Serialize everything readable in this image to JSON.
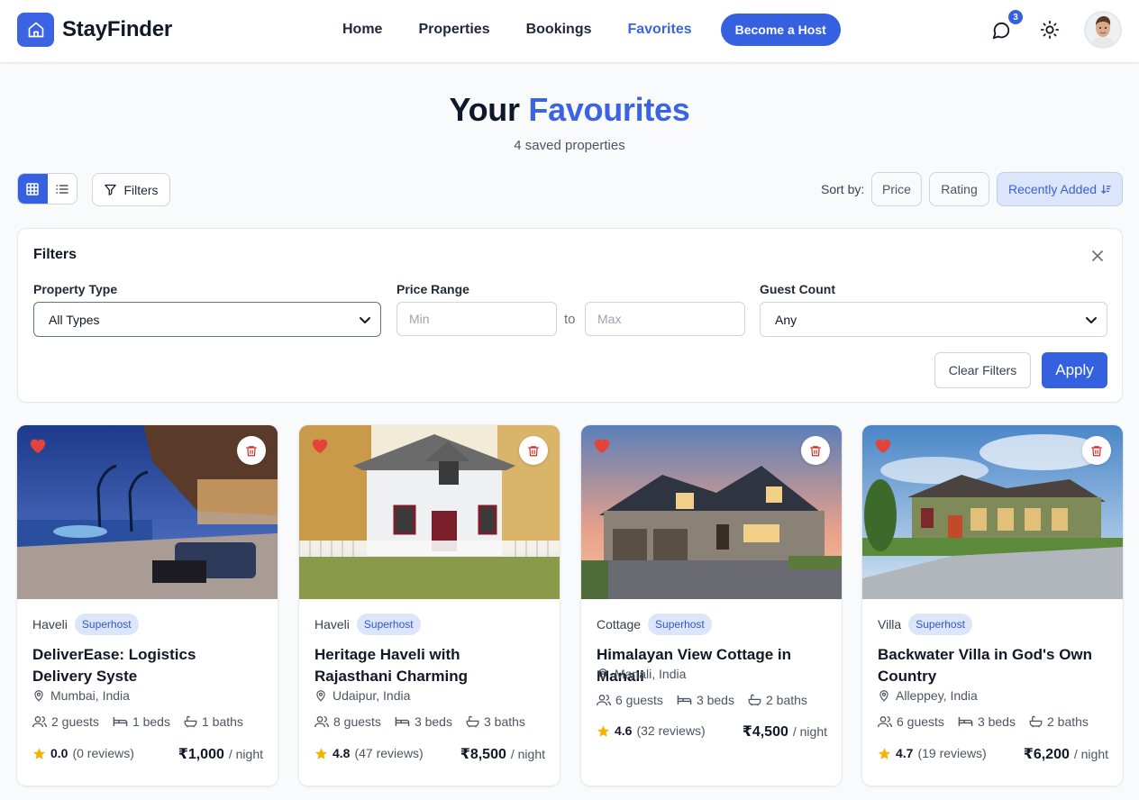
{
  "header": {
    "brand": "StayFinder",
    "nav": [
      "Home",
      "Properties",
      "Bookings",
      "Favorites"
    ],
    "active_nav": "Favorites",
    "host_button": "Become a Host",
    "notification_count": "3",
    "icons": [
      "home-icon",
      "chat-icon",
      "sun-icon",
      "user-avatar"
    ]
  },
  "page": {
    "title_prefix": "Your",
    "title_accent": "Favourites",
    "subtitle": "4 saved properties"
  },
  "toolbar": {
    "view_modes": [
      "grid",
      "list"
    ],
    "active_view": "grid",
    "filters_button": "Filters",
    "sort_label": "Sort by:",
    "sort_options": [
      "Price",
      "Rating",
      "Recently Added"
    ],
    "active_sort": "Recently Added"
  },
  "filters": {
    "title": "Filters",
    "property_type_label": "Property Type",
    "property_type_value": "All Types",
    "price_label": "Price Range",
    "price_min_placeholder": "Min",
    "price_max_placeholder": "Max",
    "price_separator": "to",
    "guest_label": "Guest Count",
    "guest_value": "Any",
    "clear_button": "Clear Filters",
    "apply_button": "Apply"
  },
  "properties": [
    {
      "type": "Haveli",
      "badge": "Superhost",
      "title": "DeliverEase: Logistics Delivery Syste",
      "location": "Mumbai, India",
      "guests": "2 guests",
      "beds": "1 beds",
      "baths": "1 baths",
      "rating": "0.0",
      "reviews": "(0 reviews)",
      "price": "₹1,000",
      "per": "/ night"
    },
    {
      "type": "Haveli",
      "badge": "Superhost",
      "title": "Heritage Haveli with Rajasthani Charming",
      "location": "Udaipur, India",
      "guests": "8 guests",
      "beds": "3 beds",
      "baths": "3 baths",
      "rating": "4.8",
      "reviews": "(47 reviews)",
      "price": "₹8,500",
      "per": "/ night"
    },
    {
      "type": "Cottage",
      "badge": "Superhost",
      "title": "Himalayan View Cottage in Manali",
      "location": "Manali, India",
      "guests": "6 guests",
      "beds": "3 beds",
      "baths": "2 baths",
      "rating": "4.6",
      "reviews": "(32 reviews)",
      "price": "₹4,500",
      "per": "/ night"
    },
    {
      "type": "Villa",
      "badge": "Superhost",
      "title": "Backwater Villa in God's Own Country",
      "location": "Alleppey, India",
      "guests": "6 guests",
      "beds": "3 beds",
      "baths": "2 baths",
      "rating": "4.7",
      "reviews": "(19 reviews)",
      "price": "₹6,200",
      "per": "/ night"
    }
  ],
  "colors": {
    "primary": "#3560e0",
    "accent_text": "#3b63e3",
    "badge_bg": "#dbe6fb",
    "heart": "#e2433b",
    "star": "#f5b301"
  }
}
